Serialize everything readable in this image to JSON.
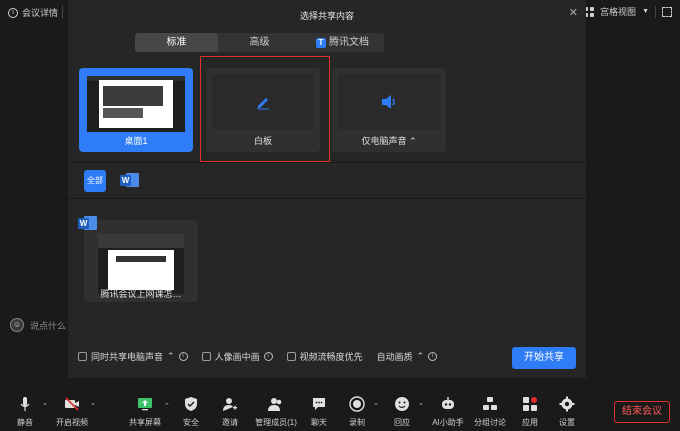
{
  "topbar": {
    "meeting_info": "会议详情",
    "gallery_view": "宫格视图"
  },
  "dialog": {
    "title": "选择共享内容",
    "tabs": [
      {
        "label": "标准",
        "active": true
      },
      {
        "label": "高级",
        "active": false
      },
      {
        "label": "腾讯文档",
        "active": false
      }
    ],
    "cards": [
      {
        "label": "桌面1",
        "selected": true
      },
      {
        "label": "白板",
        "selected": false
      },
      {
        "label": "仅电脑声音",
        "selected": false
      }
    ],
    "filters": {
      "all": "全部"
    },
    "window_card": {
      "label": "腾讯会议上网课怎…"
    },
    "options": [
      {
        "label": "同时共享电脑声音",
        "caret": true
      },
      {
        "label": "人像画中画"
      },
      {
        "label": "视频流畅度优先"
      },
      {
        "label": "自动画质"
      }
    ],
    "start_button": "开始共享"
  },
  "chat": {
    "placeholder": "说点什么"
  },
  "toolbar": {
    "items": [
      {
        "label": "静音",
        "icon": "mic-icon"
      },
      {
        "label": "开启视频",
        "icon": "video-off-icon"
      },
      {
        "label": "共享屏幕",
        "icon": "share-screen-icon"
      },
      {
        "label": "安全",
        "icon": "shield-icon"
      },
      {
        "label": "邀请",
        "icon": "invite-icon"
      },
      {
        "label": "管理成员(1)",
        "icon": "members-icon"
      },
      {
        "label": "聊天",
        "icon": "chat-icon"
      },
      {
        "label": "录制",
        "icon": "record-icon"
      },
      {
        "label": "回应",
        "icon": "reaction-icon"
      },
      {
        "label": "AI小助手",
        "icon": "ai-assistant-icon"
      },
      {
        "label": "分组讨论",
        "icon": "breakout-icon"
      },
      {
        "label": "应用",
        "icon": "apps-icon"
      },
      {
        "label": "设置",
        "icon": "settings-icon"
      }
    ],
    "end_meeting": "结束会议"
  },
  "colors": {
    "accent": "#2e7cf6",
    "danger": "#e0302e",
    "background": "#1a1a1a",
    "panel": "#262626"
  }
}
